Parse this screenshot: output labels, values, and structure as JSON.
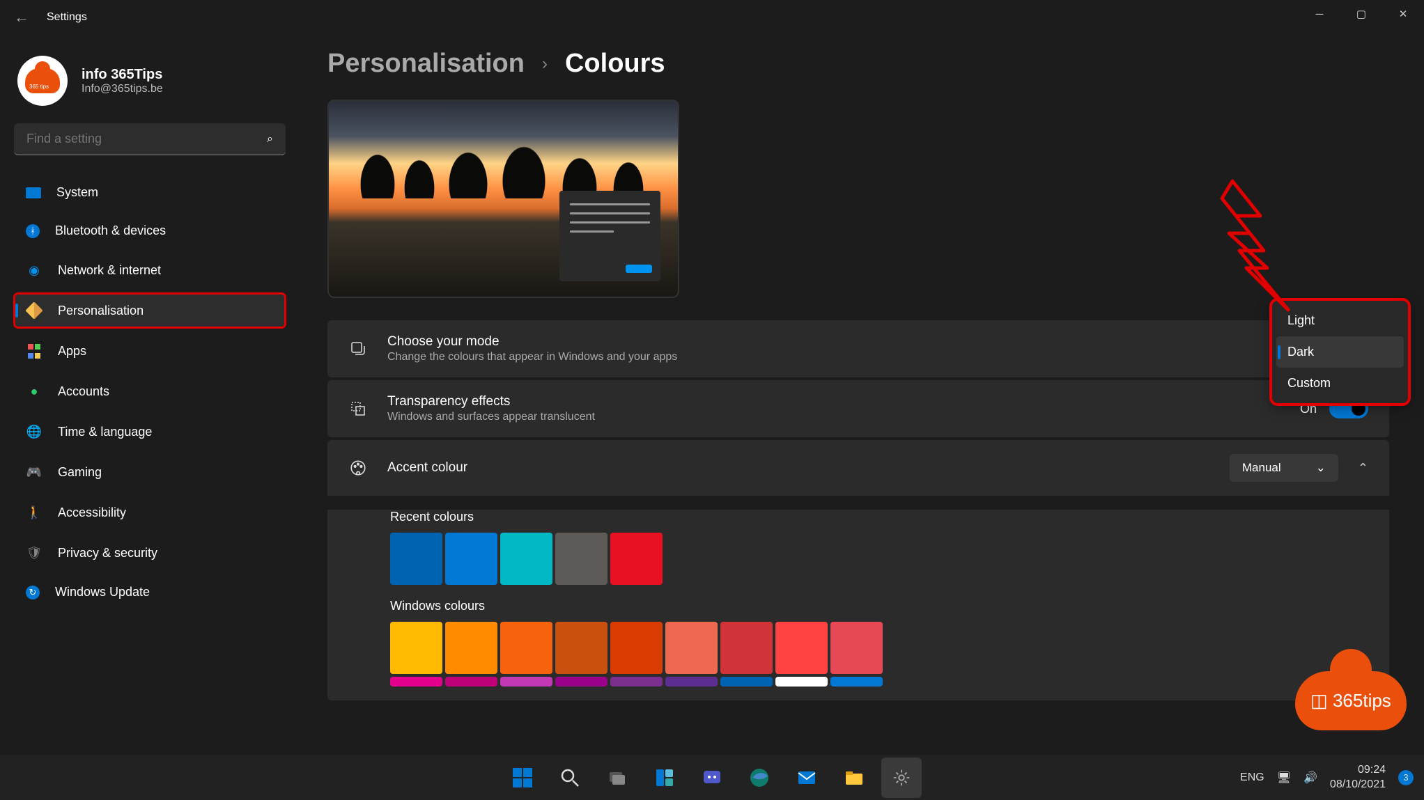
{
  "titlebar": {
    "title": "Settings"
  },
  "account": {
    "name": "info 365Tips",
    "email": "Info@365tips.be"
  },
  "search": {
    "placeholder": "Find a setting"
  },
  "nav": [
    {
      "label": "System",
      "icon": "🖥️"
    },
    {
      "label": "Bluetooth & devices",
      "icon": "bt"
    },
    {
      "label": "Network & internet",
      "icon": "wifi"
    },
    {
      "label": "Personalisation",
      "icon": "brush",
      "active": true,
      "highlighted": true
    },
    {
      "label": "Apps",
      "icon": "apps"
    },
    {
      "label": "Accounts",
      "icon": "👤"
    },
    {
      "label": "Time & language",
      "icon": "🌐"
    },
    {
      "label": "Gaming",
      "icon": "🎮"
    },
    {
      "label": "Accessibility",
      "icon": "♿"
    },
    {
      "label": "Privacy & security",
      "icon": "🛡️"
    },
    {
      "label": "Windows Update",
      "icon": "🔄"
    }
  ],
  "breadcrumb": {
    "parent": "Personalisation",
    "current": "Colours"
  },
  "cards": {
    "mode": {
      "title": "Choose your mode",
      "desc": "Change the colours that appear in Windows and your apps"
    },
    "transparency": {
      "title": "Transparency effects",
      "desc": "Windows and surfaces appear translucent",
      "toggle_label": "On"
    },
    "accent": {
      "title": "Accent colour",
      "select_value": "Manual"
    }
  },
  "recent_label": "Recent colours",
  "recent_colours": [
    "#0063b1",
    "#0078d4",
    "#00b7c3",
    "#5d5a58",
    "#e81123"
  ],
  "windows_label": "Windows colours",
  "windows_colours_row1": [
    "#ffb900",
    "#ff8c00",
    "#f7630c",
    "#ca5010",
    "#da3b01",
    "#ef6950",
    "#d13438",
    "#ff4343",
    "#e74856"
  ],
  "windows_colours_row2": [
    "#e3008c",
    "#bf0077",
    "#c239b3",
    "#9a0089",
    "#7a2f8e",
    "#5c2e91",
    "#0063b1",
    "#ffffff",
    "#0078d4"
  ],
  "dropdown": {
    "options": [
      "Light",
      "Dark",
      "Custom"
    ],
    "selected": "Dark"
  },
  "systray": {
    "lang": "ENG",
    "time": "09:24",
    "date": "08/10/2021",
    "notif_count": "3"
  },
  "logo_text": "365tips"
}
